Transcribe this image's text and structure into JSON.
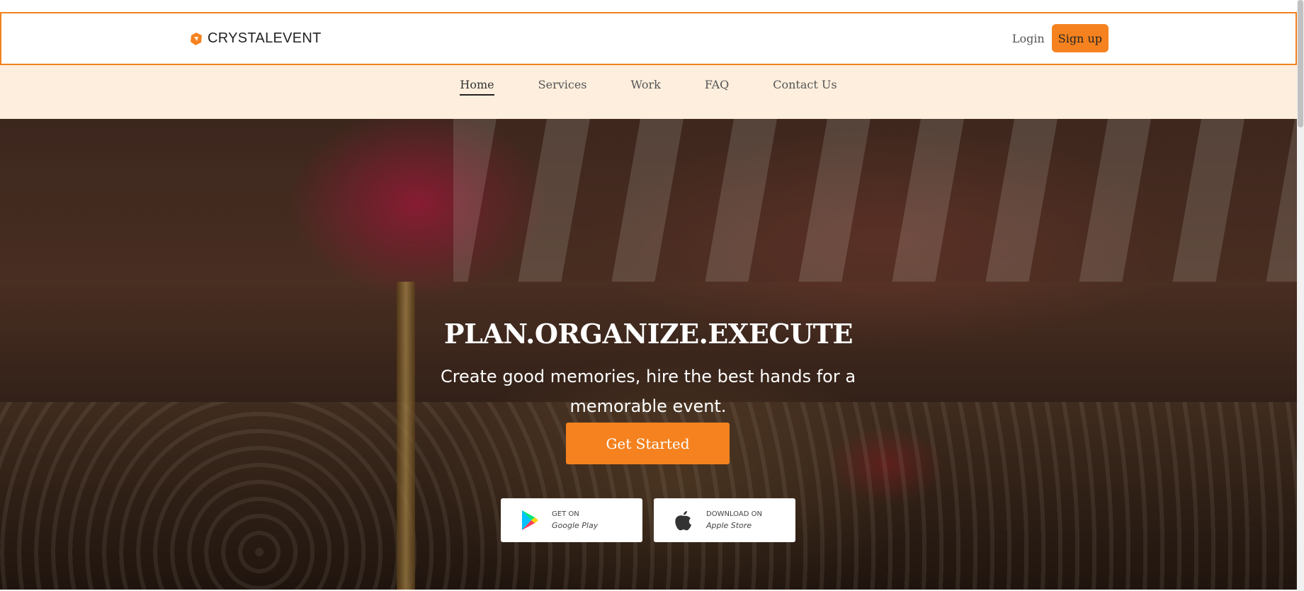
{
  "brand": {
    "name": "CRYSTALEVENT",
    "icon": "crystal-logo-icon",
    "accent": "#f5821f"
  },
  "auth": {
    "login_label": "Login",
    "signup_label": "Sign up"
  },
  "nav": {
    "items": [
      {
        "label": "Home",
        "active": true
      },
      {
        "label": "Services",
        "active": false
      },
      {
        "label": "Work",
        "active": false
      },
      {
        "label": "FAQ",
        "active": false
      },
      {
        "label": "Contact Us",
        "active": false
      }
    ],
    "background": "#fdeedd"
  },
  "hero": {
    "title": "PLAN.ORGANIZE.EXECUTE",
    "subtitle": "Create good memories, hire the best hands for a memorable event.",
    "cta_label": "Get Started",
    "stores": [
      {
        "top": "GET ON",
        "bottom": "Google Play",
        "icon": "google-play-icon"
      },
      {
        "top": "DOWNLOAD ON",
        "bottom": "Apple Store",
        "icon": "apple-icon"
      }
    ]
  }
}
